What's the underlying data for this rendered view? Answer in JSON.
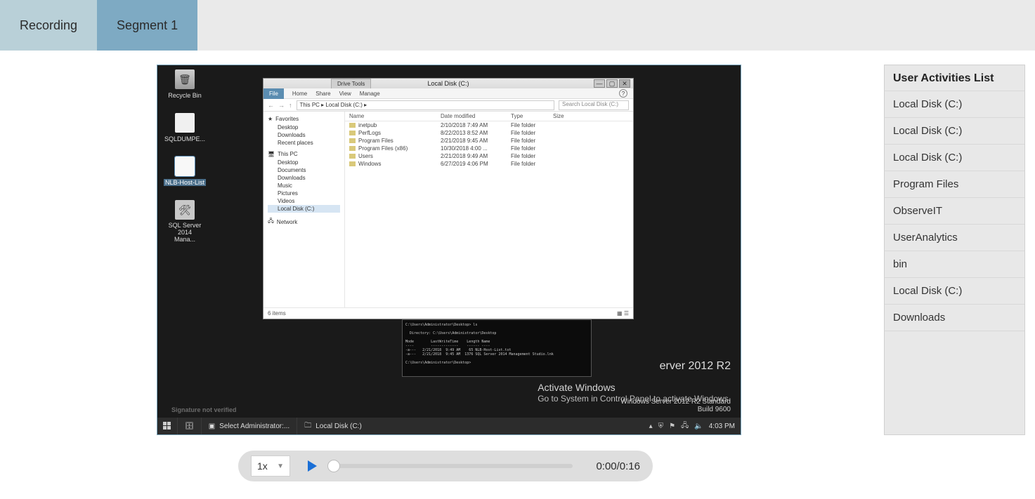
{
  "tabs": {
    "recording": "Recording",
    "segment": "Segment 1"
  },
  "desktop": {
    "icons": [
      {
        "label": "Recycle Bin"
      },
      {
        "label": "SQLDUMPE..."
      },
      {
        "label": "NLB-Host-List",
        "selected": true
      },
      {
        "label": "SQL Server 2014 Mana..."
      }
    ]
  },
  "explorer": {
    "drive_tools": "Drive Tools",
    "title": "Local Disk (C:)",
    "ribbon": {
      "file": "File",
      "home": "Home",
      "share": "Share",
      "view": "View",
      "manage": "Manage"
    },
    "breadcrumb": "This PC  ▸  Local Disk (C:)  ▸",
    "search_placeholder": "Search Local Disk (C:)",
    "nav": {
      "favorites": "Favorites",
      "fav_items": [
        "Desktop",
        "Downloads",
        "Recent places"
      ],
      "thispc": "This PC",
      "pc_items": [
        "Desktop",
        "Documents",
        "Downloads",
        "Music",
        "Pictures",
        "Videos",
        "Local Disk (C:)"
      ],
      "network": "Network"
    },
    "columns": {
      "name": "Name",
      "modified": "Date modified",
      "type": "Type",
      "size": "Size"
    },
    "rows": [
      {
        "name": "inetpub",
        "date": "2/10/2018 7:49 AM",
        "type": "File folder"
      },
      {
        "name": "PerfLogs",
        "date": "8/22/2013 8:52 AM",
        "type": "File folder"
      },
      {
        "name": "Program Files",
        "date": "2/21/2018 9:45 AM",
        "type": "File folder"
      },
      {
        "name": "Program Files (x86)",
        "date": "10/30/2018 4:00 ...",
        "type": "File folder"
      },
      {
        "name": "Users",
        "date": "2/21/2018 9:49 AM",
        "type": "File folder"
      },
      {
        "name": "Windows",
        "date": "6/27/2019 4:06 PM",
        "type": "File folder"
      }
    ],
    "status": "6 items"
  },
  "server": {
    "brand": "erver 2012 R2",
    "activate_h": "Activate Windows",
    "activate_b": "Go to System in Control Panel to activate Windows.",
    "edition": "Windows Server 2012 R2 Standard",
    "build": "Build 9600",
    "signature": "Signature not verified"
  },
  "taskbar": {
    "items": [
      "Select Administrator:...",
      "Local Disk (C:)"
    ],
    "clock": "4:03 PM"
  },
  "activities": {
    "title": "User Activities List",
    "items": [
      "Local Disk (C:)",
      "Local Disk (C:)",
      "Local Disk (C:)",
      "Program Files",
      "ObserveIT",
      "UserAnalytics",
      "bin",
      "Local Disk (C:)",
      "Downloads"
    ]
  },
  "player": {
    "speed": "1x",
    "time": "0:00/0:16"
  }
}
